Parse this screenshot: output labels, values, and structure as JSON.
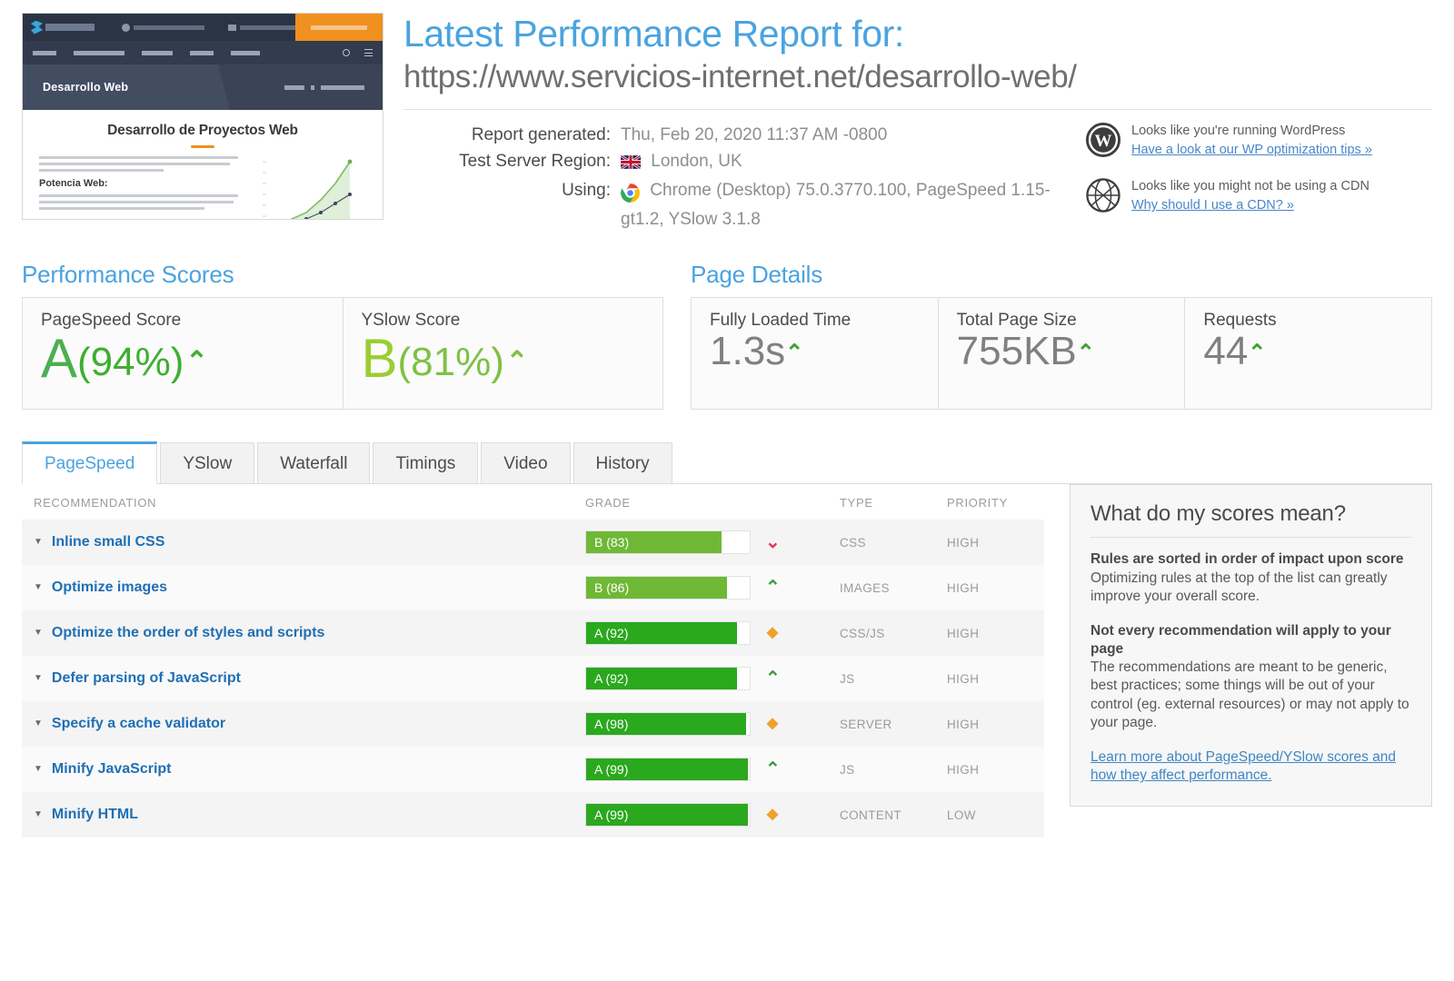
{
  "header": {
    "title": "Latest Performance Report for:",
    "url": "https://www.servicios-internet.net/desarrollo-web/",
    "meta": [
      {
        "label": "Report generated:",
        "value": "Thu, Feb 20, 2020 11:37 AM -0800",
        "icon": ""
      },
      {
        "label": "Test Server Region:",
        "value": "London, UK",
        "icon": "uk-flag-icon"
      },
      {
        "label": "Using:",
        "value": "Chrome (Desktop) 75.0.3770.100, PageSpeed 1.15-gt1.2, YSlow 3.1.8",
        "icon": "chrome-icon"
      }
    ],
    "notices": [
      {
        "icon": "wordpress-icon",
        "text": "Looks like you're running WordPress",
        "link": "Have a look at our WP optimization tips »"
      },
      {
        "icon": "globe-cdn-icon",
        "text": "Looks like you might not be using a CDN",
        "link": "Why should I use a CDN? »"
      }
    ]
  },
  "thumbnail": {
    "site_title": "Desarrollo Web",
    "page_heading": "Desarrollo de Proyectos Web",
    "sub_heading": "Potencia Web:",
    "cta_label": "",
    "accent_color": "#f0901f",
    "header_color": "#2b3445"
  },
  "performance_scores": {
    "section_title": "Performance Scores",
    "items": [
      {
        "label": "PageSpeed Score",
        "grade": "A",
        "percent": "(94%)",
        "trend": "⌃",
        "grade_color": "#4caf50",
        "pct_color": "#3fae33",
        "trend_color": "#3fae33"
      },
      {
        "label": "YSlow Score",
        "grade": "B",
        "percent": "(81%)",
        "trend": "⌃",
        "grade_color": "#9acd32",
        "pct_color": "#7dc244",
        "trend_color": "#7dc244"
      }
    ]
  },
  "page_details": {
    "section_title": "Page Details",
    "items": [
      {
        "label": "Fully Loaded Time",
        "value": "1.3s",
        "trend": "⌃"
      },
      {
        "label": "Total Page Size",
        "value": "755KB",
        "trend": "⌃"
      },
      {
        "label": "Requests",
        "value": "44",
        "trend": "⌃"
      }
    ]
  },
  "tabs": [
    {
      "label": "PageSpeed",
      "active": true
    },
    {
      "label": "YSlow",
      "active": false
    },
    {
      "label": "Waterfall",
      "active": false
    },
    {
      "label": "Timings",
      "active": false
    },
    {
      "label": "Video",
      "active": false
    },
    {
      "label": "History",
      "active": false
    }
  ],
  "table": {
    "columns": [
      "RECOMMENDATION",
      "GRADE",
      "TYPE",
      "PRIORITY"
    ],
    "rows": [
      {
        "recommendation": "Inline small CSS",
        "grade": "B (83)",
        "score": 83,
        "bar_color": "#6fb836",
        "trend": "⌄",
        "trend_kind": "down",
        "trend_color": "#e0395a",
        "type": "CSS",
        "priority": "HIGH"
      },
      {
        "recommendation": "Optimize images",
        "grade": "B (86)",
        "score": 86,
        "bar_color": "#6fb836",
        "trend": "⌃",
        "trend_kind": "up",
        "trend_color": "#3d9e42",
        "type": "IMAGES",
        "priority": "HIGH"
      },
      {
        "recommendation": "Optimize the order of styles and scripts",
        "grade": "A (92)",
        "score": 92,
        "bar_color": "#2aa81e",
        "trend": "◆",
        "trend_kind": "diamond",
        "trend_color": "#f0a12a",
        "type": "CSS/JS",
        "priority": "HIGH"
      },
      {
        "recommendation": "Defer parsing of JavaScript",
        "grade": "A (92)",
        "score": 92,
        "bar_color": "#2aa81e",
        "trend": "⌃",
        "trend_kind": "up",
        "trend_color": "#3d9e42",
        "type": "JS",
        "priority": "HIGH"
      },
      {
        "recommendation": "Specify a cache validator",
        "grade": "A (98)",
        "score": 98,
        "bar_color": "#2aa81e",
        "trend": "◆",
        "trend_kind": "diamond",
        "trend_color": "#f0a12a",
        "type": "SERVER",
        "priority": "HIGH"
      },
      {
        "recommendation": "Minify JavaScript",
        "grade": "A (99)",
        "score": 99,
        "bar_color": "#2aa81e",
        "trend": "⌃",
        "trend_kind": "up",
        "trend_color": "#3d9e42",
        "type": "JS",
        "priority": "HIGH"
      },
      {
        "recommendation": "Minify HTML",
        "grade": "A (99)",
        "score": 99,
        "bar_color": "#2aa81e",
        "trend": "◆",
        "trend_kind": "diamond",
        "trend_color": "#f0a12a",
        "type": "CONTENT",
        "priority": "LOW"
      }
    ]
  },
  "sidebar": {
    "title": "What do my scores mean?",
    "blocks": [
      {
        "heading": "Rules are sorted in order of impact upon score",
        "body": "Optimizing rules at the top of the list can greatly improve your overall score."
      },
      {
        "heading": "Not every recommendation will apply to your page",
        "body": "The recommendations are meant to be generic, best practices; some things will be out of your control (eg. external resources) or may not apply to your page."
      }
    ],
    "link": "Learn more about PageSpeed/YSlow scores and how they affect performance."
  }
}
